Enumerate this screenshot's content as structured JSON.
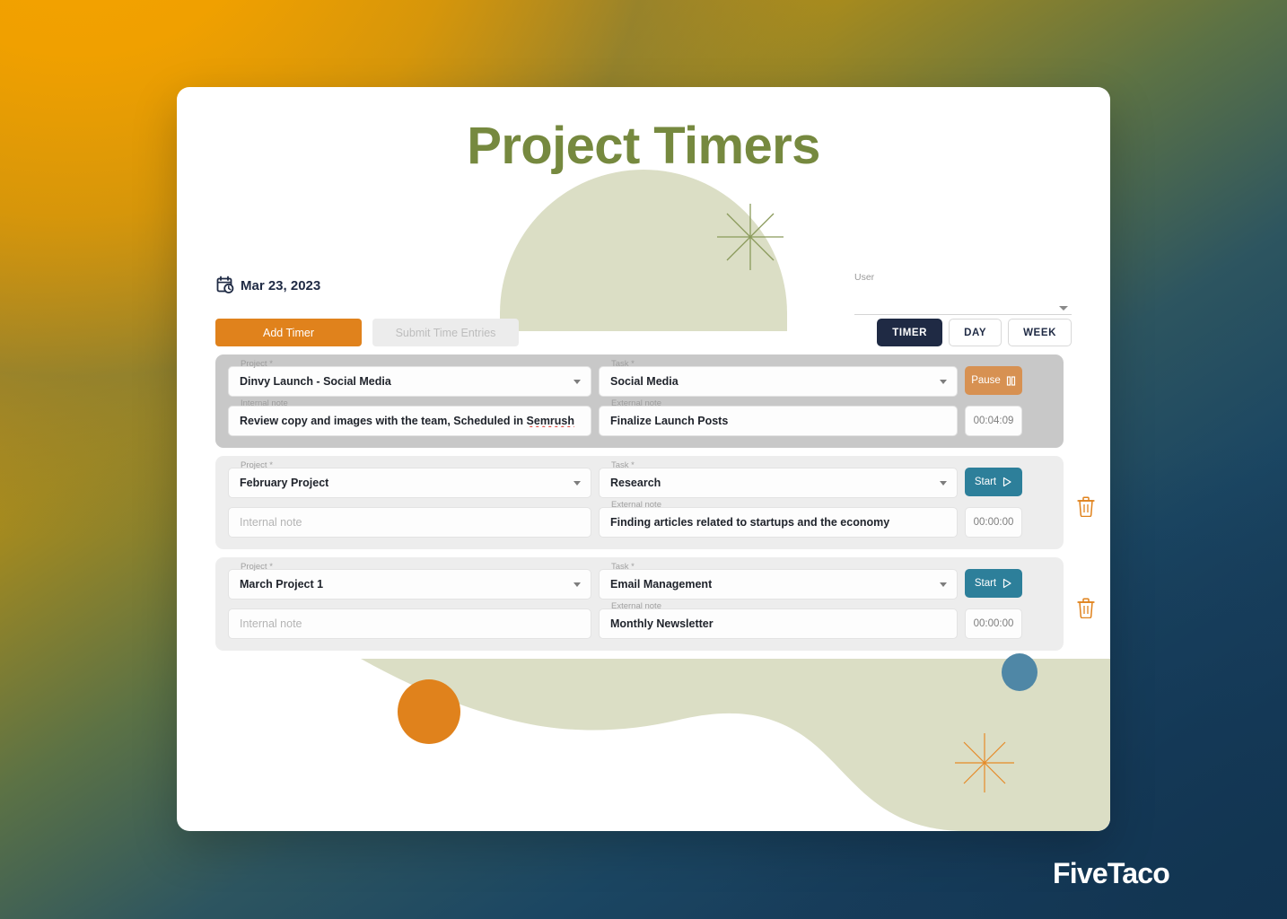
{
  "brand": {
    "name": "FiveTaco"
  },
  "header": {
    "title": "Project Timers"
  },
  "toolbar": {
    "date": "Mar 23, 2023",
    "calendar_icon": "calendar-clock-icon",
    "add_timer_label": "Add Timer",
    "submit_label": "Submit Time Entries",
    "user_label": "User",
    "user_value": "",
    "views": [
      {
        "label": "TIMER",
        "active": true
      },
      {
        "label": "DAY",
        "active": false
      },
      {
        "label": "WEEK",
        "active": false
      }
    ]
  },
  "fields": {
    "project_label": "Project *",
    "task_label": "Task *",
    "internal_label": "Internal note",
    "external_label": "External note",
    "internal_placeholder": "Internal note"
  },
  "timers": [
    {
      "running": true,
      "project": "Dinvy Launch - Social Media",
      "task": "Social Media",
      "internal_note": "Review copy and images with the team, Scheduled in ",
      "internal_note_misspelled": "Semrush",
      "external_note": "Finalize Launch Posts",
      "elapsed": "00:04:09",
      "action_label": "Pause",
      "action_icon": "pause-icon",
      "has_delete": false
    },
    {
      "running": false,
      "project": "February Project",
      "task": "Research",
      "internal_note": "",
      "internal_note_misspelled": "",
      "external_note": "Finding articles related to startups and the economy",
      "elapsed": "00:00:00",
      "action_label": "Start",
      "action_icon": "play-icon",
      "has_delete": true
    },
    {
      "running": false,
      "project": "March Project 1",
      "task": "Email Management",
      "internal_note": "",
      "internal_note_misspelled": "",
      "external_note": "Monthly Newsletter",
      "elapsed": "00:00:00",
      "action_label": "Start",
      "action_icon": "play-icon",
      "has_delete": true
    }
  ],
  "colors": {
    "accent_orange": "#e0821c",
    "accent_teal": "#2d7f9a",
    "title_green": "#76893f",
    "sage": "#dbdec5",
    "navy": "#1f2a44"
  }
}
